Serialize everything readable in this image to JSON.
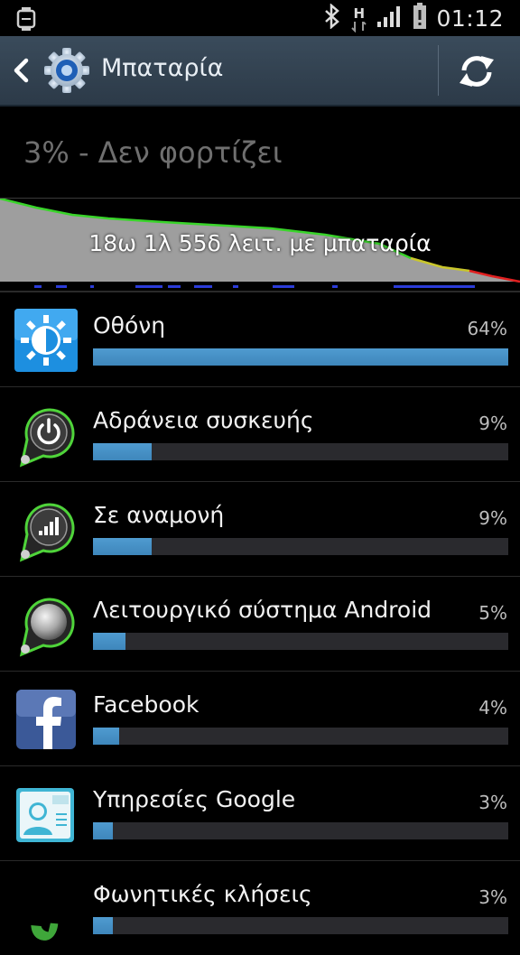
{
  "status_bar": {
    "time": "01:12",
    "network_letter": "H",
    "icons": [
      "watch-icon",
      "bluetooth-icon",
      "hspa-data-icon",
      "signal-icon",
      "battery-alert-icon"
    ]
  },
  "action_bar": {
    "title": "Μπαταρία",
    "icons": [
      "back-chevron-icon",
      "gear-icon",
      "refresh-icon"
    ]
  },
  "battery": {
    "status_text": "3% - Δεν φορτίζει",
    "usage_text": "18ω 1λ 55δ λειτ. με μπαταρία"
  },
  "items": [
    {
      "name": "Οθόνη",
      "percent_label": "64%",
      "fraction": 0.64,
      "icon": "brightness-icon"
    },
    {
      "name": "Αδράνεια συσκευής",
      "percent_label": "9%",
      "fraction": 0.09,
      "icon": "power-icon"
    },
    {
      "name": "Σε αναμονή",
      "percent_label": "9%",
      "fraction": 0.09,
      "icon": "cell-standby-icon"
    },
    {
      "name": "Λειτουργικό σύστημα Android",
      "percent_label": "5%",
      "fraction": 0.05,
      "icon": "android-os-icon"
    },
    {
      "name": "Facebook",
      "percent_label": "4%",
      "fraction": 0.04,
      "icon": "facebook-icon"
    },
    {
      "name": "Υπηρεσίες Google",
      "percent_label": "3%",
      "fraction": 0.03,
      "icon": "google-services-icon"
    },
    {
      "name": "Φωνητικές κλήσεις",
      "percent_label": "3%",
      "fraction": 0.03,
      "icon": "phone-icon"
    }
  ],
  "colors": {
    "accent_bar": "#4a94c9",
    "action_bar": "#34454f",
    "graph_line_green": "#39d42a",
    "graph_line_yellow": "#c9c62b",
    "graph_line_red": "#e02020"
  }
}
